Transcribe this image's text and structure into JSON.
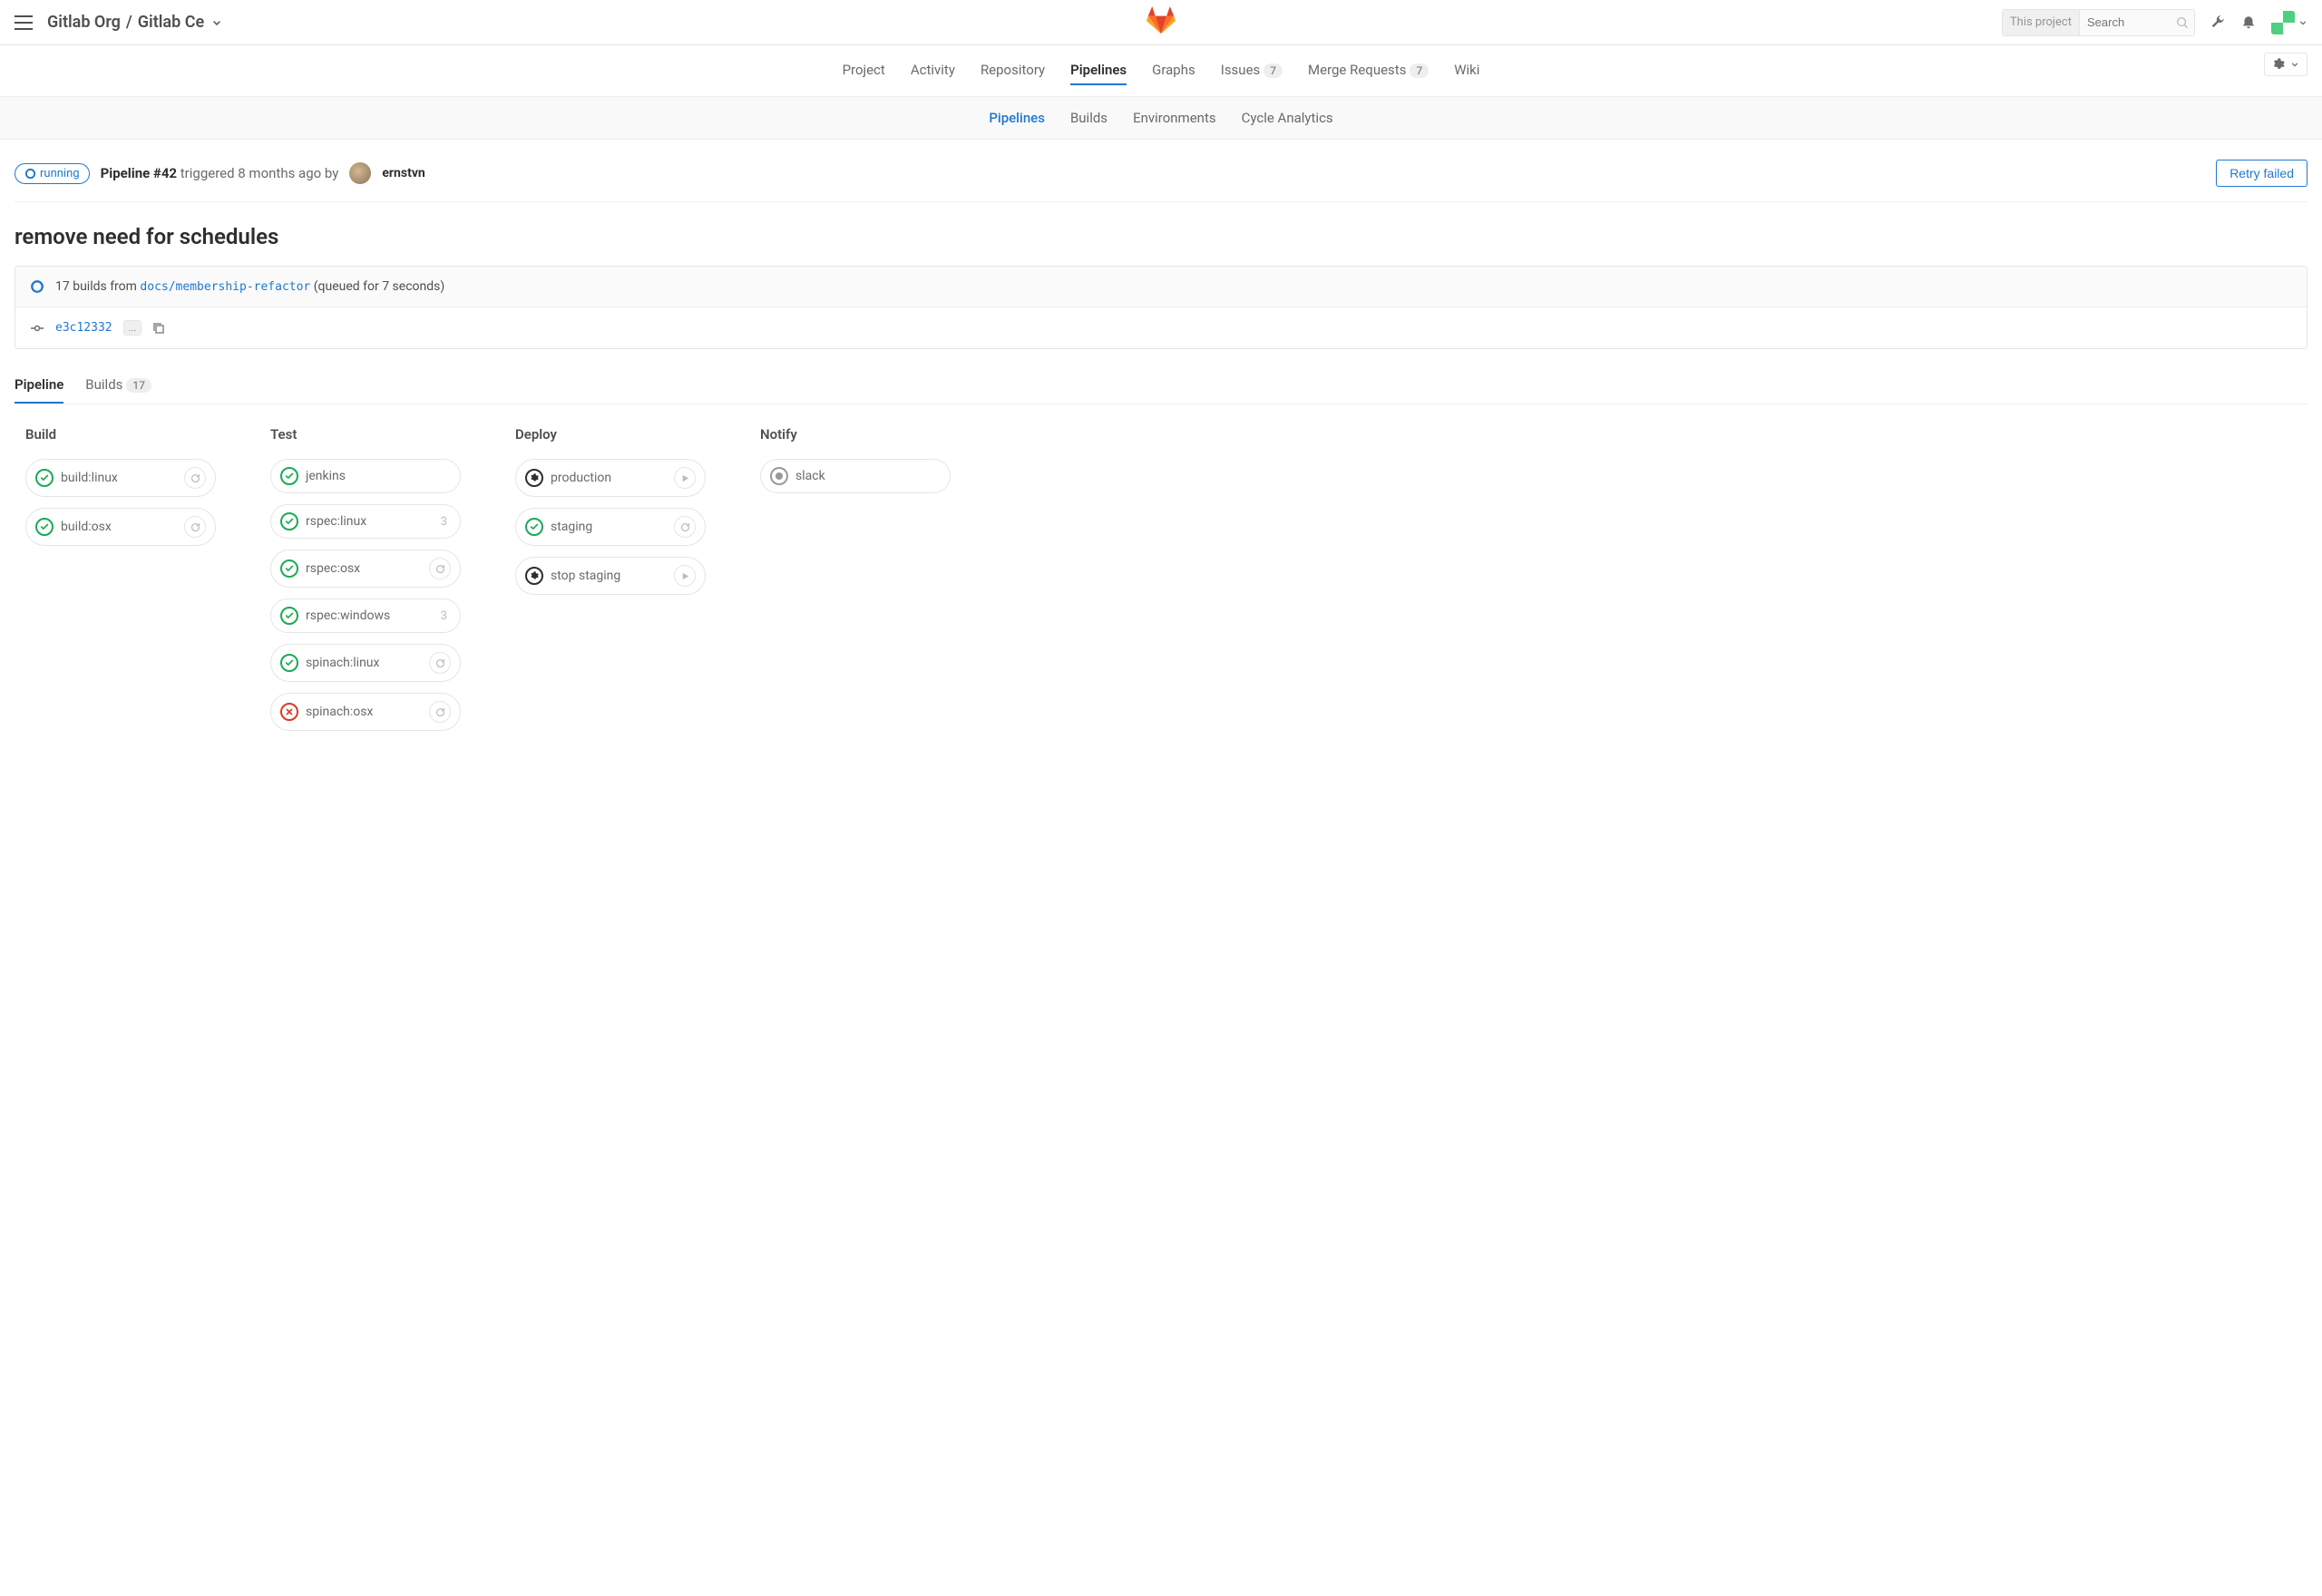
{
  "breadcrumb": {
    "org": "Gitlab Org",
    "project": "Gitlab Ce"
  },
  "search": {
    "scope": "This project",
    "placeholder": "Search"
  },
  "nav": {
    "project": "Project",
    "activity": "Activity",
    "repository": "Repository",
    "pipelines": "Pipelines",
    "graphs": "Graphs",
    "issues": "Issues",
    "issues_count": "7",
    "merge_requests": "Merge Requests",
    "mr_count": "7",
    "wiki": "Wiki"
  },
  "subnav": {
    "pipelines": "Pipelines",
    "builds": "Builds",
    "environments": "Environments",
    "cycle": "Cycle Analytics"
  },
  "pipeline": {
    "status": "running",
    "id_label": "Pipeline #42",
    "trigger_text": "triggered 8 months ago by",
    "user": "ernstvn",
    "retry_label": "Retry failed",
    "title": "remove need for schedules",
    "builds_from_pre": "17 builds from",
    "branch": "docs/membership-refactor",
    "queued": "(queued for 7 seconds)",
    "sha": "e3c12332",
    "ellipsis": "..."
  },
  "view_tabs": {
    "pipeline": "Pipeline",
    "builds": "Builds",
    "builds_count": "17"
  },
  "stages": [
    {
      "name": "Build",
      "jobs": [
        {
          "name": "build:linux",
          "status": "success",
          "action": "retry"
        },
        {
          "name": "build:osx",
          "status": "success",
          "action": "retry"
        }
      ]
    },
    {
      "name": "Test",
      "jobs": [
        {
          "name": "jenkins",
          "status": "success",
          "action": "none"
        },
        {
          "name": "rspec:linux",
          "status": "success",
          "count": "3",
          "action": "none"
        },
        {
          "name": "rspec:osx",
          "status": "success",
          "action": "retry"
        },
        {
          "name": "rspec:windows",
          "status": "success",
          "count": "3",
          "action": "none"
        },
        {
          "name": "spinach:linux",
          "status": "success",
          "action": "retry"
        },
        {
          "name": "spinach:osx",
          "status": "failed",
          "action": "retry"
        }
      ]
    },
    {
      "name": "Deploy",
      "jobs": [
        {
          "name": "production",
          "status": "manual",
          "action": "play"
        },
        {
          "name": "staging",
          "status": "success",
          "action": "retry"
        },
        {
          "name": "stop staging",
          "status": "manual",
          "action": "play"
        }
      ]
    },
    {
      "name": "Notify",
      "jobs": [
        {
          "name": "slack",
          "status": "skipped",
          "action": "none"
        }
      ]
    }
  ]
}
